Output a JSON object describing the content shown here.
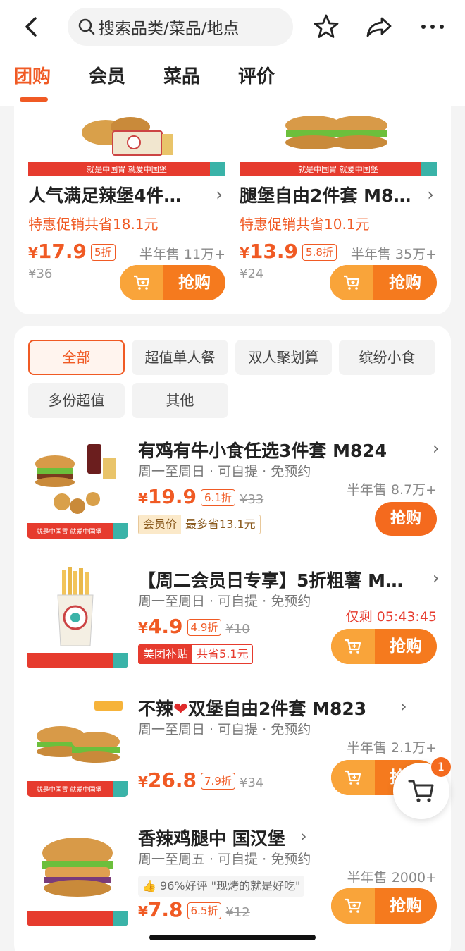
{
  "header": {
    "search_placeholder": "搜索品类/菜品/地点",
    "tabs": [
      "团购",
      "会员",
      "菜品",
      "评价"
    ]
  },
  "top_deals": [
    {
      "title": "人气满足辣堡4件…",
      "promo": "特惠促销共省18.1元",
      "price_symbol": "¥",
      "price": "17.9",
      "discount": "5折",
      "sold": "半年售 11万+",
      "original": "¥36",
      "button": "抢购"
    },
    {
      "title": "腿堡自由2件套 M8…",
      "promo": "特惠促销共省10.1元",
      "price_symbol": "¥",
      "price": "13.9",
      "discount": "5.8折",
      "sold": "半年售 35万+",
      "original": "¥24",
      "button": "抢购"
    }
  ],
  "banner_text": "就是中国胃 就爱中国堡",
  "filters": [
    "全部",
    "超值单人餐",
    "双人聚划算",
    "缤纷小食",
    "多份超值",
    "其他"
  ],
  "items": [
    {
      "name": "有鸡有牛小食任选3件套 M824",
      "meta": "周一至周日 · 可自提 · 免预约",
      "price_symbol": "¥",
      "price": "19.9",
      "discount": "6.1折",
      "original": "¥33",
      "right_info": "半年售 8.7万+",
      "tag_left": "会员价",
      "tag_right": "最多省13.1元",
      "button": "抢购"
    },
    {
      "name": "【周二会员日专享】5折粗薯 M…",
      "meta": "周一至周日 · 可自提 · 免预约",
      "price_symbol": "¥",
      "price": "4.9",
      "discount": "4.9折",
      "original": "¥10",
      "right_info": "仅剩 05:43:45",
      "tag_left": "美团补贴",
      "tag_right": "共省5.1元",
      "button": "抢购"
    },
    {
      "name_a": "不辣",
      "name_b": "双堡自由2件套 M823",
      "meta": "周一至周日 · 可自提 · 免预约",
      "price_symbol": "¥",
      "price": "26.8",
      "discount": "7.9折",
      "original": "¥34",
      "right_info": "半年售 2.1万+",
      "button": "抢购"
    },
    {
      "name": "香辣鸡腿中 国汉堡",
      "meta": "周一至周五 · 可自提 · 免预约",
      "review": "96%好评 \"现烤的就是好吃\"",
      "price_symbol": "¥",
      "price": "7.8",
      "discount": "6.5折",
      "original": "¥12",
      "right_info": "半年售 2000+",
      "button": "抢购"
    }
  ],
  "cart_badge": "1",
  "colors": {
    "accent": "#f05a24",
    "button": "#f46a1e",
    "button_light": "#f9a43a"
  }
}
